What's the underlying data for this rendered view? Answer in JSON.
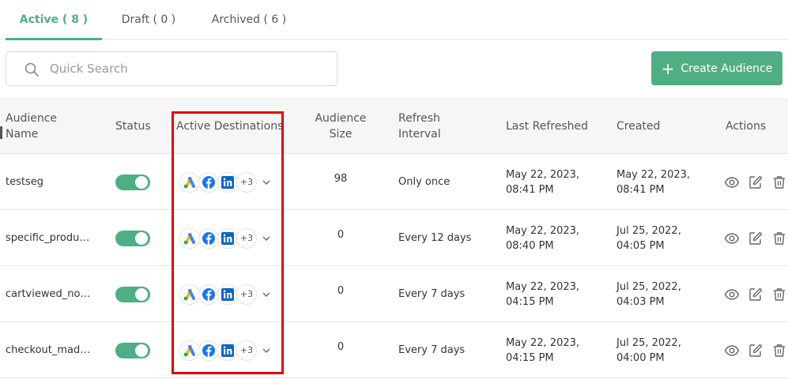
{
  "tabs": [
    {
      "label": "Active ( 8 )",
      "active": true
    },
    {
      "label": "Draft ( 0 )",
      "active": false
    },
    {
      "label": "Archived ( 6 )",
      "active": false
    }
  ],
  "search": {
    "placeholder": "Quick Search",
    "value": ""
  },
  "create_button": {
    "label": "Create Audience"
  },
  "columns": {
    "name": "Audience Name",
    "status": "Status",
    "destinations": "Active Destinations",
    "size": "Audience Size",
    "refresh": "Refresh Interval",
    "last_refreshed": "Last Refreshed",
    "created": "Created",
    "actions": "Actions"
  },
  "rows": [
    {
      "name": "testseg",
      "status_on": true,
      "destinations": [
        "google-ads-icon",
        "facebook-icon",
        "linkedin-icon"
      ],
      "more": "+3",
      "size": "98",
      "refresh": "Only once",
      "last_refreshed": "May 22, 2023, 08:41 PM",
      "created": "May 22, 2023, 08:41 PM"
    },
    {
      "name": "specific_produ…",
      "status_on": true,
      "destinations": [
        "google-ads-icon",
        "facebook-icon",
        "linkedin-icon"
      ],
      "more": "+3",
      "size": "0",
      "refresh": "Every 12 days",
      "last_refreshed": "May 22, 2023, 08:40 PM",
      "created": "Jul 25, 2022, 04:05 PM"
    },
    {
      "name": "cartviewed_no…",
      "status_on": true,
      "destinations": [
        "google-ads-icon",
        "facebook-icon",
        "linkedin-icon"
      ],
      "more": "+3",
      "size": "0",
      "refresh": "Every 7 days",
      "last_refreshed": "May 22, 2023, 04:15 PM",
      "created": "Jul 25, 2022, 04:03 PM"
    },
    {
      "name": "checkout_mad…",
      "status_on": true,
      "destinations": [
        "google-ads-icon",
        "facebook-icon",
        "linkedin-icon"
      ],
      "more": "+3",
      "size": "0",
      "refresh": "Every 7 days",
      "last_refreshed": "May 22, 2023, 04:15 PM",
      "created": "Jul 25, 2022, 04:00 PM"
    }
  ],
  "colors": {
    "accent": "#4fae84",
    "highlight": "#e50000",
    "google_blue": "#4285f4",
    "google_yellow": "#fbbc04",
    "google_green": "#34a853",
    "facebook": "#1877f2",
    "linkedin": "#0a66c2"
  }
}
